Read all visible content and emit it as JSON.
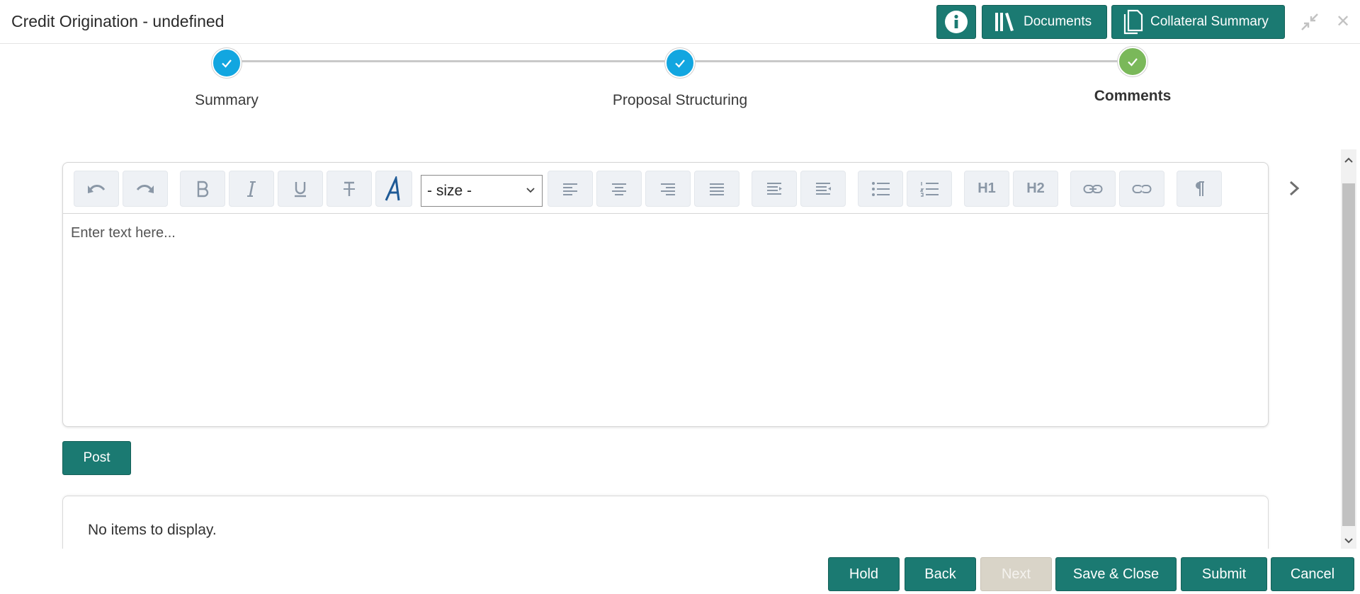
{
  "header": {
    "title": "Credit Origination - undefined",
    "buttons": {
      "documents": "Documents",
      "collateral_summary": "Collateral Summary"
    }
  },
  "stepper": {
    "steps": [
      {
        "label": "Summary",
        "state": "completed"
      },
      {
        "label": "Proposal Structuring",
        "state": "completed"
      },
      {
        "label": "Comments",
        "state": "active"
      }
    ]
  },
  "editor": {
    "size_select": "- size -",
    "toolbar_text": {
      "h1": "H1",
      "h2": "H2"
    },
    "placeholder": "Enter text here..."
  },
  "post_button": "Post",
  "comments": {
    "empty_text": "No items to display."
  },
  "footer": {
    "hold": "Hold",
    "back": "Back",
    "next": "Next",
    "save_close": "Save & Close",
    "submit": "Submit",
    "cancel": "Cancel"
  },
  "colors": {
    "primary": "#1b7a72",
    "step_done": "#12a6e0",
    "step_active": "#7ab85a",
    "disabled": "#d9d4c8"
  }
}
